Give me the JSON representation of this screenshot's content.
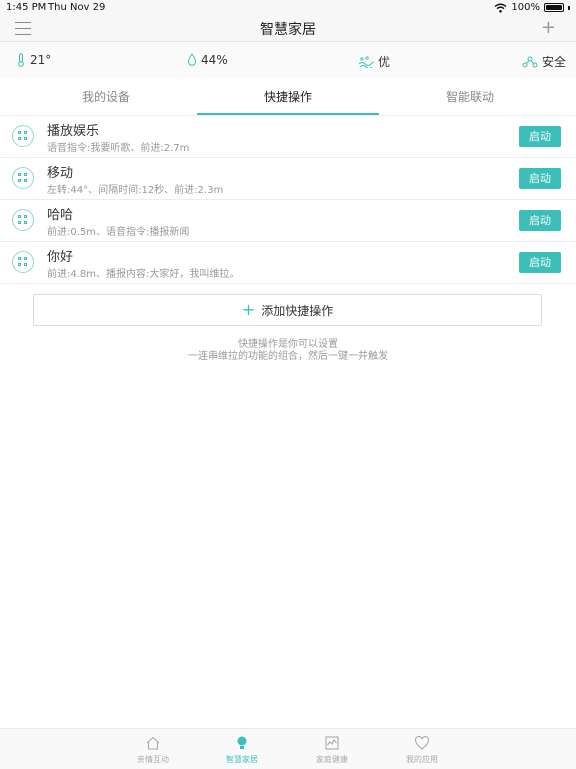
{
  "status": {
    "time": "1:45 PM",
    "date": "Thu Nov 29",
    "battery": "100%"
  },
  "nav": {
    "title": "智慧家居"
  },
  "env": {
    "temperature": "21°",
    "humidity": "44%",
    "air": "优",
    "security": "安全"
  },
  "tabs": [
    {
      "label": "我的设备"
    },
    {
      "label": "快捷操作"
    },
    {
      "label": "智能联动"
    }
  ],
  "active_tab": "快捷操作",
  "actions": [
    {
      "title": "播放娱乐",
      "detail": "语音指令:我要听歌、前进:2.7m",
      "button": "启动"
    },
    {
      "title": "移动",
      "detail": "左转:44°、间隔时间:12秒、前进:2.3m",
      "button": "启动"
    },
    {
      "title": "哈哈",
      "detail": "前进:0.5m、语音指令:播报新闻",
      "button": "启动"
    },
    {
      "title": "你好",
      "detail": "前进:4.8m、播报内容:大家好，我叫维拉。",
      "button": "启动"
    }
  ],
  "add_button": {
    "label": "添加快捷操作"
  },
  "hint": {
    "line1": "快捷操作是你可以设置",
    "line2": "一连串维拉的功能的组合，然后一键一并触发"
  },
  "bottom_nav": [
    {
      "label": "亲情互动",
      "icon": "home-icon"
    },
    {
      "label": "智慧家居",
      "icon": "bulb-icon"
    },
    {
      "label": "家庭健康",
      "icon": "health-chart-icon"
    },
    {
      "label": "我的应用",
      "icon": "heart-icon"
    }
  ],
  "accent_color": "#3dbfb9"
}
